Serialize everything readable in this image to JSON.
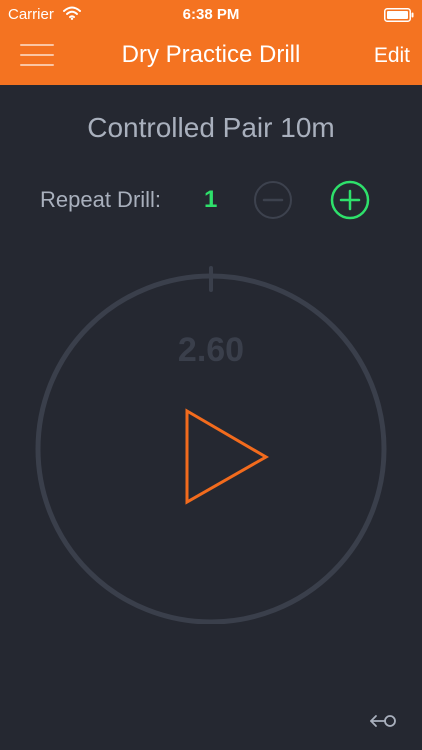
{
  "status_bar": {
    "carrier": "Carrier",
    "time": "6:38 PM"
  },
  "nav": {
    "title": "Dry Practice Drill",
    "edit_label": "Edit",
    "menu_icon": "hamburger-menu-icon"
  },
  "drill": {
    "name": "Controlled Pair 10m",
    "repeat_label": "Repeat Drill:",
    "repeat_count": "1"
  },
  "timer": {
    "readout": "2.60"
  },
  "icons": {
    "minus": "minus-circle-icon",
    "plus": "plus-circle-icon",
    "play": "play-icon",
    "back": "back-arrow-icon"
  },
  "colors": {
    "header": "#f47321",
    "background": "#252831",
    "accent_green": "#2ee06b",
    "play_orange": "#f26b1d",
    "dial_ring": "#3a3f4b",
    "muted_text": "#a9b0bd"
  }
}
